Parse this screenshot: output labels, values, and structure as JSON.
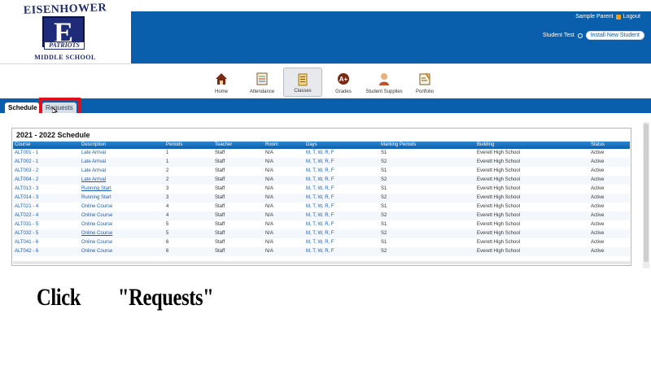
{
  "school": {
    "logo_top": "EISENHOWER",
    "logo_letter": "E",
    "logo_band": "PATRIOTS",
    "logo_bottom": "MIDDLE SCHOOL"
  },
  "header": {
    "user_name": "Sample Parent",
    "logout_label": "Logout",
    "student_label": "Student Test",
    "install_button": "Install New Student"
  },
  "nav": {
    "items": [
      {
        "label": "Home",
        "icon": "home-icon"
      },
      {
        "label": "Attendance",
        "icon": "attendance-icon"
      },
      {
        "label": "Classes",
        "icon": "classes-icon"
      },
      {
        "label": "Grades",
        "icon": "grades-icon"
      },
      {
        "label": "Student Supplies",
        "icon": "student-icon"
      },
      {
        "label": "Portfolio",
        "icon": "portfolio-icon"
      }
    ],
    "active": "Classes"
  },
  "tabs": {
    "schedule": "Schedule",
    "requests": "Requests"
  },
  "schedule": {
    "title": "2021 - 2022 Schedule",
    "columns": [
      "Course",
      "Description",
      "Periods",
      "Teacher",
      "Room",
      "Days",
      "Marking Periods",
      "Building",
      "Status"
    ],
    "rows": [
      [
        "ALT001 - 1",
        "Late Arrival",
        "1",
        "Staff",
        "N/A",
        "M, T, W, R, F",
        "S1",
        "Everett High School",
        "Active"
      ],
      [
        "ALT002 - 1",
        "Late Arrival",
        "1",
        "Staff",
        "N/A",
        "M, T, W, R, F",
        "S2",
        "Everett High School",
        "Active"
      ],
      [
        "ALT003 - 2",
        "Late Arrival",
        "2",
        "Staff",
        "N/A",
        "M, T, W, R, F",
        "S1",
        "Everett High School",
        "Active"
      ],
      [
        "ALT004 - 2",
        "Late Arrival",
        "2",
        "Staff",
        "N/A",
        "M, T, W, R, F",
        "S2",
        "Everett High School",
        "Active"
      ],
      [
        "ALT013 - 3",
        "Running Start",
        "3",
        "Staff",
        "N/A",
        "M, T, W, R, F",
        "S1",
        "Everett High School",
        "Active"
      ],
      [
        "ALT014 - 3",
        "Running Start",
        "3",
        "Staff",
        "N/A",
        "M, T, W, R, F",
        "S2",
        "Everett High School",
        "Active"
      ],
      [
        "ALT021 - 4",
        "Online Course",
        "4",
        "Staff",
        "N/A",
        "M, T, W, R, F",
        "S1",
        "Everett High School",
        "Active"
      ],
      [
        "ALT022 - 4",
        "Online Course",
        "4",
        "Staff",
        "N/A",
        "M, T, W, R, F",
        "S2",
        "Everett High School",
        "Active"
      ],
      [
        "ALT031 - 5",
        "Online Course",
        "5",
        "Staff",
        "N/A",
        "M, T, W, R, F",
        "S1",
        "Everett High School",
        "Active"
      ],
      [
        "ALT032 - 5",
        "Online Course",
        "5",
        "Staff",
        "N/A",
        "M, T, W, R, F",
        "S2",
        "Everett High School",
        "Active"
      ],
      [
        "ALT041 - 6",
        "Online Course",
        "6",
        "Staff",
        "N/A",
        "M, T, W, R, F",
        "S1",
        "Everett High School",
        "Active"
      ],
      [
        "ALT042 - 6",
        "Online Course",
        "6",
        "Staff",
        "N/A",
        "M, T, W, R, F",
        "S2",
        "Everett High School",
        "Active"
      ]
    ]
  },
  "caption": {
    "text": "Click        \"Requests\""
  },
  "colors": {
    "brand_blue": "#0a5fad",
    "highlight_red": "#e0101a",
    "logout_orange": "#f2a012"
  }
}
